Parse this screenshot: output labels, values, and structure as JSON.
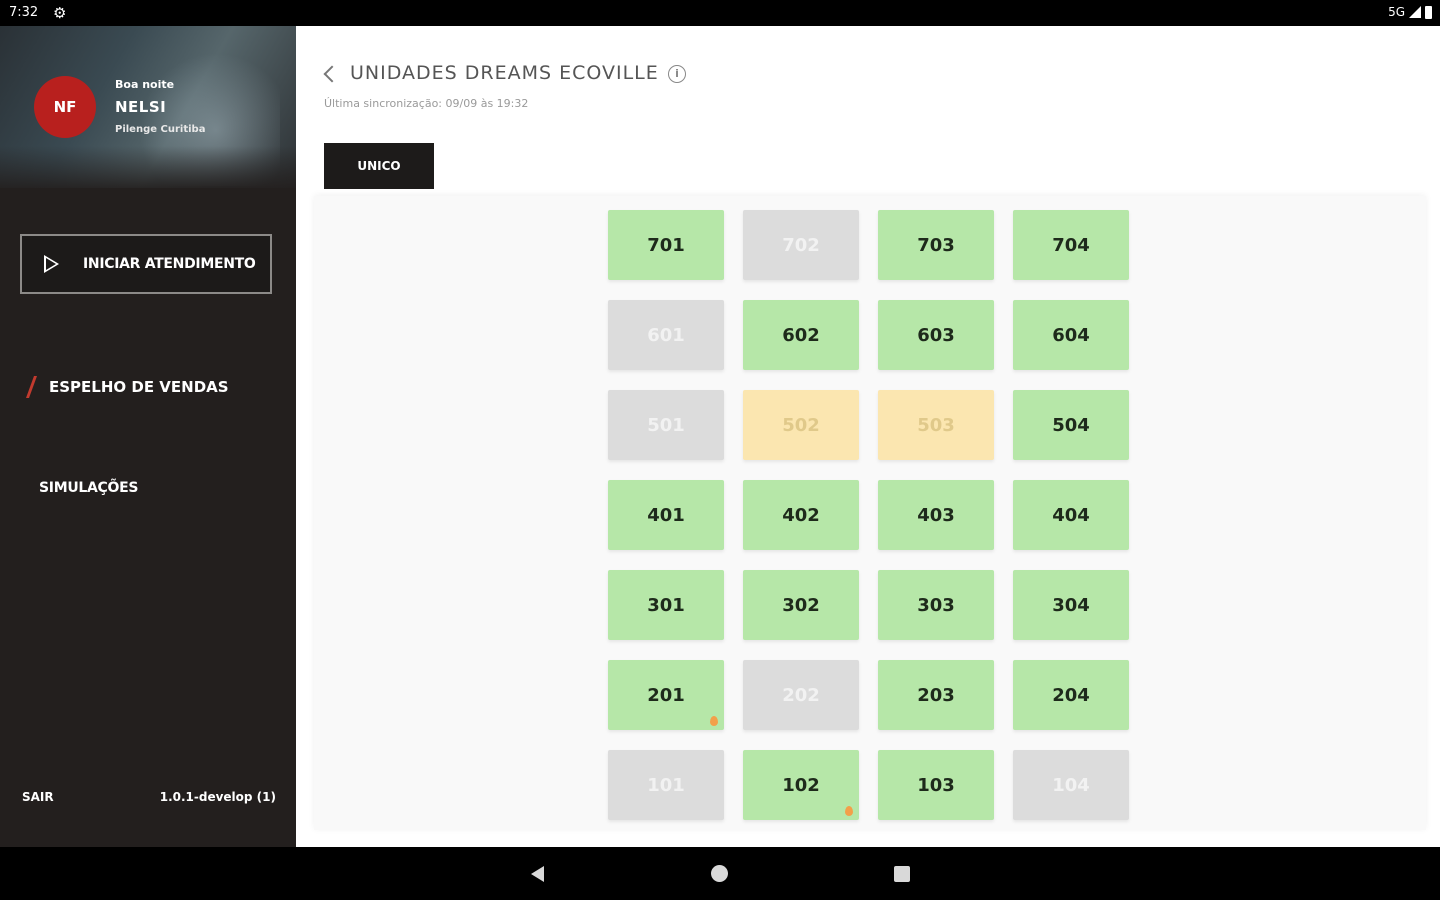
{
  "status_bar": {
    "time": "7:32",
    "network": "5G"
  },
  "sidebar": {
    "avatar_initials": "NF",
    "greeting": "Boa noite",
    "user_name": "NELSI",
    "organization": "Pilenge Curitiba",
    "start_button_label": "INICIAR ATENDIMENTO",
    "nav_active": "ESPELHO DE VENDAS",
    "nav_item": "SIMULAÇÕES",
    "logout_label": "SAIR",
    "version": "1.0.1-develop (1)"
  },
  "main": {
    "title": "UNIDADES DREAMS ECOVILLE",
    "sync_text": "Última sincronização: 09/09 às 19:32",
    "tab_label": "UNICO"
  },
  "units": [
    [
      {
        "n": "701",
        "s": "available"
      },
      {
        "n": "702",
        "s": "sold"
      },
      {
        "n": "703",
        "s": "available"
      },
      {
        "n": "704",
        "s": "available"
      }
    ],
    [
      {
        "n": "601",
        "s": "sold"
      },
      {
        "n": "602",
        "s": "available"
      },
      {
        "n": "603",
        "s": "available"
      },
      {
        "n": "604",
        "s": "available"
      }
    ],
    [
      {
        "n": "501",
        "s": "sold"
      },
      {
        "n": "502",
        "s": "reserved"
      },
      {
        "n": "503",
        "s": "reserved"
      },
      {
        "n": "504",
        "s": "available"
      }
    ],
    [
      {
        "n": "401",
        "s": "available"
      },
      {
        "n": "402",
        "s": "available"
      },
      {
        "n": "403",
        "s": "available"
      },
      {
        "n": "404",
        "s": "available"
      }
    ],
    [
      {
        "n": "301",
        "s": "available"
      },
      {
        "n": "302",
        "s": "available"
      },
      {
        "n": "303",
        "s": "available"
      },
      {
        "n": "304",
        "s": "available"
      }
    ],
    [
      {
        "n": "201",
        "s": "available",
        "hot": true
      },
      {
        "n": "202",
        "s": "sold"
      },
      {
        "n": "203",
        "s": "available"
      },
      {
        "n": "204",
        "s": "available"
      }
    ],
    [
      {
        "n": "101",
        "s": "sold"
      },
      {
        "n": "102",
        "s": "available",
        "hot": true
      },
      {
        "n": "103",
        "s": "available"
      },
      {
        "n": "104",
        "s": "sold"
      }
    ]
  ],
  "colors": {
    "available": "#b6e7a8",
    "sold": "#dcdcdc",
    "reserved": "#fbe6b0",
    "accent": "#b8201e"
  }
}
